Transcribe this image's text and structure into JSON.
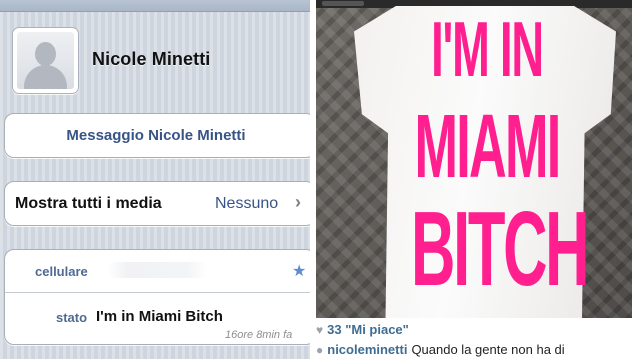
{
  "contact": {
    "name": "Nicole Minetti",
    "message_button": "Messaggio Nicole Minetti",
    "media_label": "Mostra tutti i media",
    "media_value": "Nessuno",
    "fields": {
      "mobile_label": "cellulare",
      "status_label": "stato",
      "status_value": "I'm in Miami Bitch",
      "status_time": "16ore 8min fa"
    }
  },
  "post": {
    "shirt_text": [
      "I'M IN",
      "MIAMI",
      "BITCH"
    ],
    "likes": "33 \"Mi piace\"",
    "username": "nicoleminetti",
    "caption": "Quando la gente non ha di"
  },
  "colors": {
    "ios_blue": "#385487",
    "label_blue": "#4f6a93",
    "neon_pink": "#ff1f8f",
    "instagram_blue": "#3e6d93"
  },
  "icons": {
    "avatar": "person-silhouette-icon",
    "chevron": "chevron-right-icon",
    "favorite": "star-icon",
    "like": "heart-icon",
    "comment": "comment-icon"
  }
}
